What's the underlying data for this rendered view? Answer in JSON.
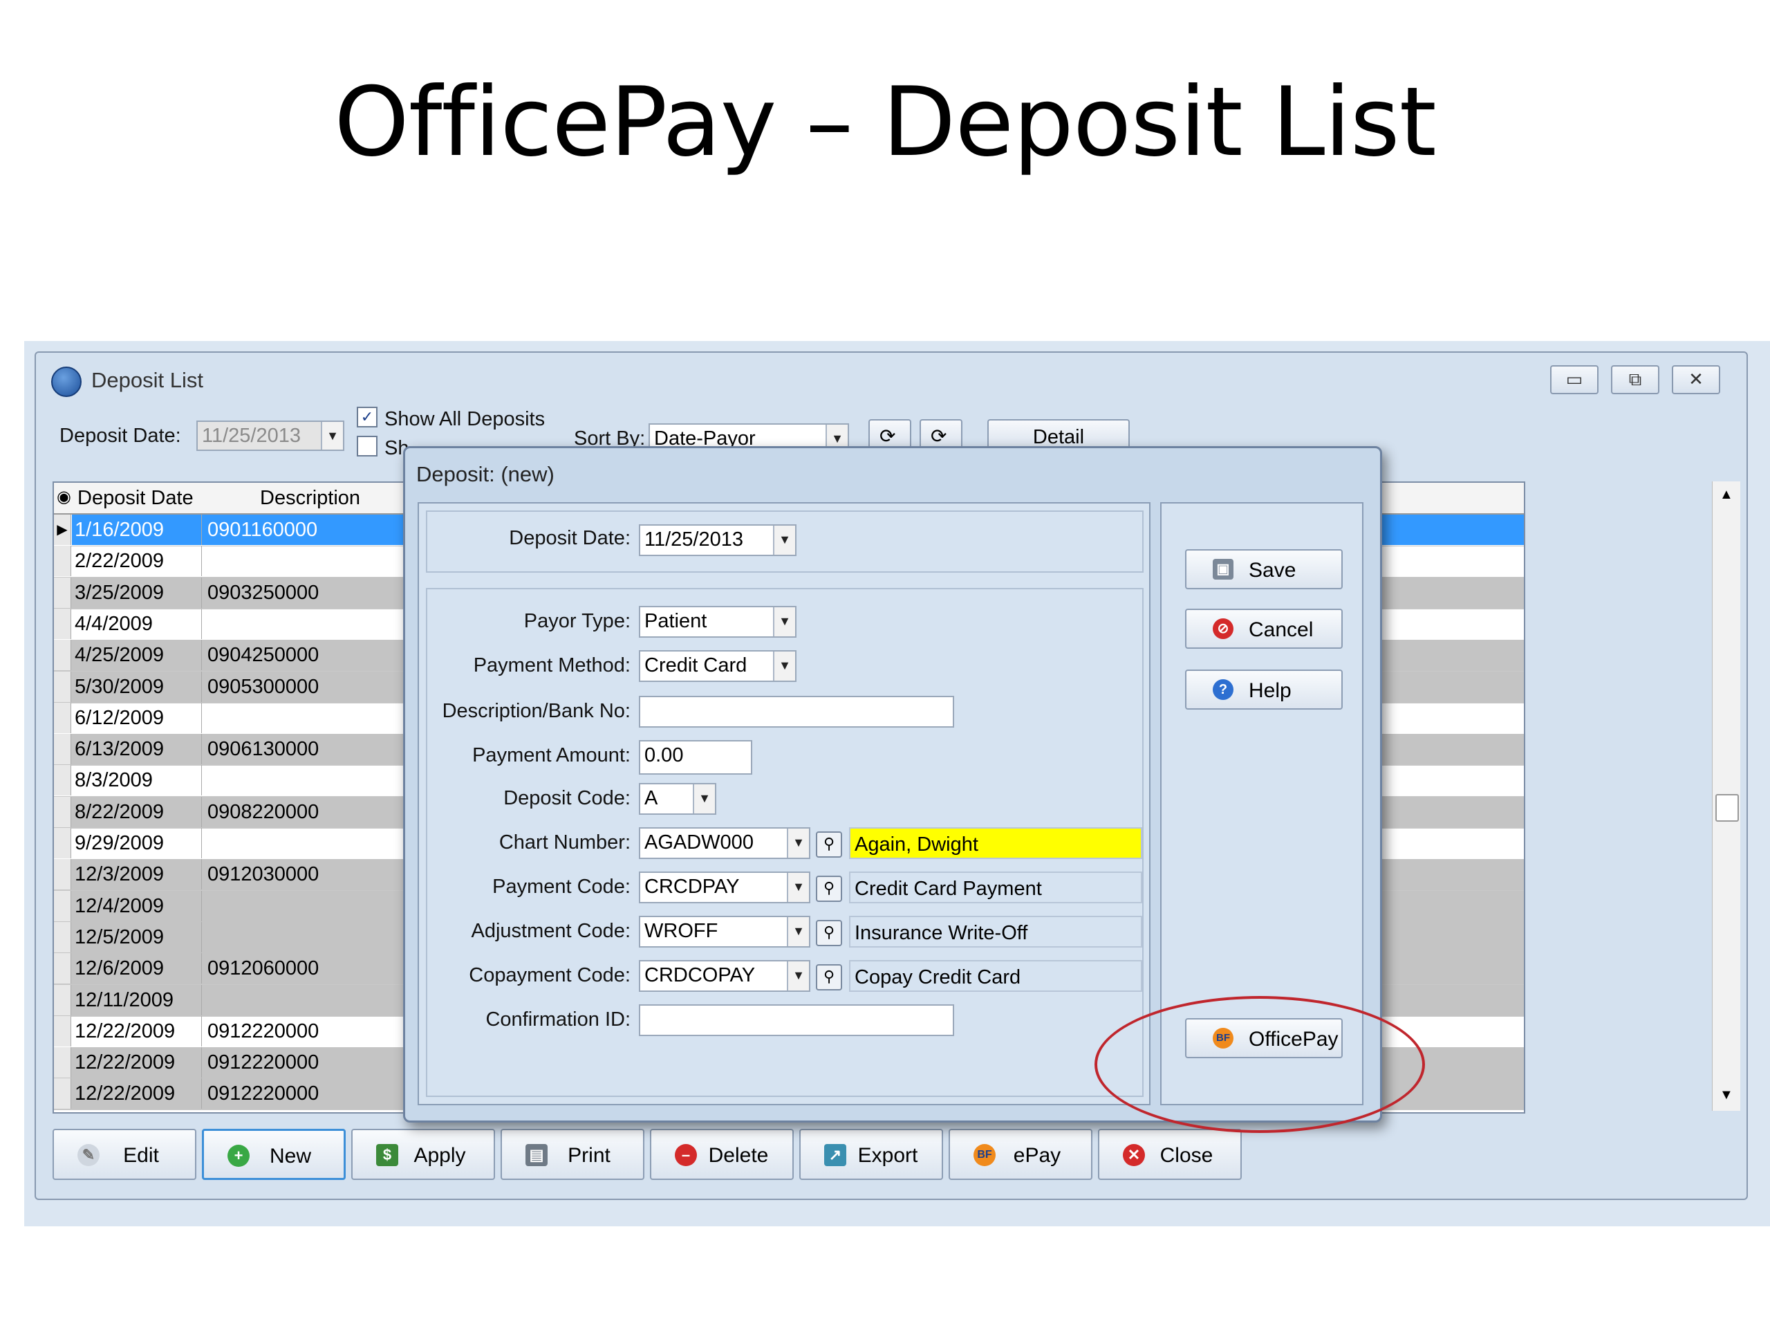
{
  "slide": {
    "title": "OfficePay – Deposit List"
  },
  "window": {
    "title": "Deposit List",
    "controls": {
      "minimize": "▭",
      "restore": "⧉",
      "close": "✕"
    }
  },
  "filters": {
    "deposit_date_label": "Deposit Date:",
    "deposit_date_value": "11/25/2013",
    "show_all_label": "Show All Deposits",
    "show_all_checked": true,
    "show_other_label": "Sh",
    "sort_by_label": "Sort By:",
    "sort_by_value": "Date-Payor",
    "detail_label": "Detail"
  },
  "grid": {
    "columns": [
      "Deposit Date",
      "Description"
    ],
    "rows": [
      {
        "date": "1/16/2009",
        "desc": "0901160000",
        "selected": true
      },
      {
        "date": "2/22/2009",
        "desc": ""
      },
      {
        "date": "3/25/2009",
        "desc": "0903250000"
      },
      {
        "date": "4/4/2009",
        "desc": ""
      },
      {
        "date": "4/25/2009",
        "desc": "0904250000"
      },
      {
        "date": "5/30/2009",
        "desc": "0905300000"
      },
      {
        "date": "6/12/2009",
        "desc": ""
      },
      {
        "date": "6/13/2009",
        "desc": "0906130000"
      },
      {
        "date": "8/3/2009",
        "desc": ""
      },
      {
        "date": "8/22/2009",
        "desc": "0908220000"
      },
      {
        "date": "9/29/2009",
        "desc": ""
      },
      {
        "date": "12/3/2009",
        "desc": "0912030000"
      },
      {
        "date": "12/4/2009",
        "desc": ""
      },
      {
        "date": "12/5/2009",
        "desc": ""
      },
      {
        "date": "12/6/2009",
        "desc": "0912060000"
      },
      {
        "date": "12/11/2009",
        "desc": ""
      },
      {
        "date": "12/22/2009",
        "desc": "0912220000"
      },
      {
        "date": "12/22/2009",
        "desc": "0912220000"
      },
      {
        "date": "12/22/2009",
        "desc": "0912220000"
      }
    ]
  },
  "bottom_buttons": [
    {
      "label": "Edit",
      "icon": "edit-icon"
    },
    {
      "label": "New",
      "icon": "plus-icon"
    },
    {
      "label": "Apply",
      "icon": "apply-icon"
    },
    {
      "label": "Print",
      "icon": "printer-icon"
    },
    {
      "label": "Delete",
      "icon": "delete-icon"
    },
    {
      "label": "Export",
      "icon": "export-icon"
    },
    {
      "label": "ePay",
      "icon": "bf-logo-icon"
    },
    {
      "label": "Close",
      "icon": "close-icon"
    }
  ],
  "dialog": {
    "title": "Deposit: (new)",
    "deposit_date_label": "Deposit Date:",
    "deposit_date_value": "11/25/2013",
    "payor_type_label": "Payor Type:",
    "payor_type_value": "Patient",
    "payment_method_label": "Payment Method:",
    "payment_method_value": "Credit Card",
    "description_label": "Description/Bank No:",
    "description_value": "",
    "payment_amount_label": "Payment Amount:",
    "payment_amount_value": "0.00",
    "deposit_code_label": "Deposit Code:",
    "deposit_code_value": "A",
    "chart_number_label": "Chart Number:",
    "chart_number_value": "AGADW000",
    "chart_number_name": "Again, Dwight",
    "payment_code_label": "Payment Code:",
    "payment_code_value": "CRCDPAY",
    "payment_code_desc": "Credit Card Payment",
    "adjustment_code_label": "Adjustment Code:",
    "adjustment_code_value": "WROFF",
    "adjustment_code_desc": "Insurance Write-Off",
    "copayment_code_label": "Copayment Code:",
    "copayment_code_value": "CRDCOPAY",
    "copayment_code_desc": "Copay Credit Card",
    "confirmation_label": "Confirmation ID:",
    "confirmation_value": "",
    "save_label": "Save",
    "cancel_label": "Cancel",
    "help_label": "Help",
    "officepay_label": "OfficePay"
  },
  "colors": {
    "highlight_yellow": "#ffff00",
    "selection_blue": "#3399ff",
    "annotation_red": "#c0262d"
  }
}
